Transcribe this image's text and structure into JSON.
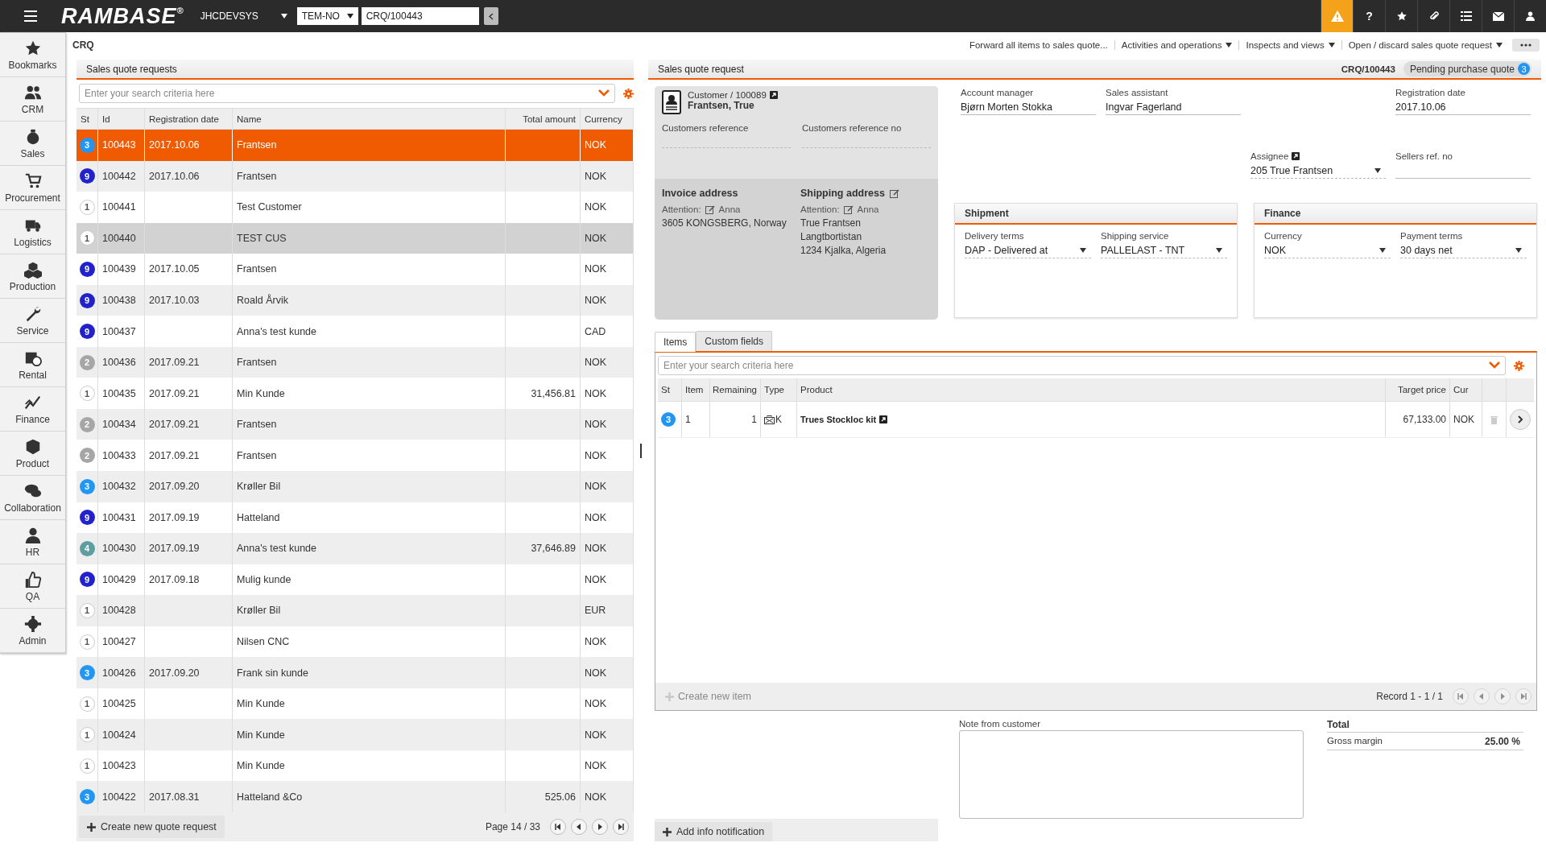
{
  "header": {
    "app_name": "RAMBASE",
    "registered": "®",
    "system": "JHCDEVSYS",
    "company": "TEM-NO",
    "document": "CRQ/100443",
    "help": "?"
  },
  "sidebar": {
    "items": [
      {
        "label": "Bookmarks"
      },
      {
        "label": "CRM"
      },
      {
        "label": "Sales"
      },
      {
        "label": "Procurement"
      },
      {
        "label": "Logistics"
      },
      {
        "label": "Production"
      },
      {
        "label": "Service"
      },
      {
        "label": "Rental"
      },
      {
        "label": "Finance"
      },
      {
        "label": "Product"
      },
      {
        "label": "Collaboration"
      },
      {
        "label": "HR"
      },
      {
        "label": "QA"
      },
      {
        "label": "Admin"
      }
    ]
  },
  "page_title": "CRQ",
  "actions": [
    {
      "label": "Forward all items to sales quote...",
      "dropdown": false
    },
    {
      "label": "Activities and operations",
      "dropdown": true
    },
    {
      "label": "Inspects and views",
      "dropdown": true
    },
    {
      "label": "Open / discard sales quote request",
      "dropdown": true
    }
  ],
  "list": {
    "title": "Sales quote requests",
    "search": {
      "placeholder": "Enter your search criteria here"
    },
    "columns": [
      "St",
      "Id",
      "Registration date",
      "Name",
      "Total amount",
      "Currency"
    ],
    "rows": [
      {
        "status": "3",
        "color": "#2196f3",
        "id": "100443",
        "date": "2017.10.06",
        "name": "Frantsen",
        "currency": "NOK",
        "selected": true,
        "hovered": false
      },
      {
        "status": "9",
        "color": "#2222cc",
        "id": "100442",
        "date": "2017.10.06",
        "name": "Frantsen",
        "currency": "NOK",
        "selected": false,
        "hovered": false
      },
      {
        "status": "1",
        "color": "#ffffff",
        "id": "100441",
        "name": "Test Customer",
        "currency": "NOK",
        "selected": false,
        "hovered": false
      },
      {
        "status": "1",
        "color": "#ffffff",
        "id": "100440",
        "name": "TEST CUS",
        "currency": "NOK",
        "selected": false,
        "hovered": true
      },
      {
        "status": "9",
        "color": "#2222cc",
        "id": "100439",
        "date": "2017.10.05",
        "name": "Frantsen",
        "currency": "NOK",
        "selected": false,
        "hovered": false
      },
      {
        "status": "9",
        "color": "#2222cc",
        "id": "100438",
        "date": "2017.10.03",
        "name": "Roald Årvik",
        "currency": "NOK",
        "selected": false,
        "hovered": false
      },
      {
        "status": "9",
        "color": "#2222cc",
        "id": "100437",
        "name": "Anna's test kunde",
        "currency": "CAD",
        "selected": false,
        "hovered": false
      },
      {
        "status": "2",
        "color": "#a6a6a6",
        "id": "100436",
        "date": "2017.09.21",
        "name": "Frantsen",
        "currency": "NOK",
        "selected": false,
        "hovered": false
      },
      {
        "status": "1",
        "color": "#ffffff",
        "id": "100435",
        "date": "2017.09.21",
        "name": "Min Kunde",
        "total": "31,456.81",
        "currency": "NOK",
        "selected": false,
        "hovered": false
      },
      {
        "status": "2",
        "color": "#a6a6a6",
        "id": "100434",
        "date": "2017.09.21",
        "name": "Frantsen",
        "currency": "NOK",
        "selected": false,
        "hovered": false
      },
      {
        "status": "2",
        "color": "#a6a6a6",
        "id": "100433",
        "date": "2017.09.21",
        "name": "Frantsen",
        "currency": "NOK",
        "selected": false,
        "hovered": false
      },
      {
        "status": "3",
        "color": "#2196f3",
        "id": "100432",
        "date": "2017.09.20",
        "name": "Krøller Bil",
        "currency": "NOK",
        "selected": false,
        "hovered": false
      },
      {
        "status": "9",
        "color": "#2222cc",
        "id": "100431",
        "date": "2017.09.19",
        "name": "Hatteland",
        "currency": "NOK",
        "selected": false,
        "hovered": false
      },
      {
        "status": "4",
        "color": "#5f9ea0",
        "id": "100430",
        "date": "2017.09.19",
        "name": "Anna's test kunde",
        "total": "37,646.89",
        "currency": "NOK",
        "selected": false,
        "hovered": false
      },
      {
        "status": "9",
        "color": "#2222cc",
        "id": "100429",
        "date": "2017.09.18",
        "name": "Mulig kunde",
        "currency": "NOK",
        "selected": false,
        "hovered": false
      },
      {
        "status": "1",
        "color": "#ffffff",
        "id": "100428",
        "name": "Krøller Bil",
        "currency": "EUR",
        "selected": false,
        "hovered": false
      },
      {
        "status": "1",
        "color": "#ffffff",
        "id": "100427",
        "name": "Nilsen CNC",
        "currency": "NOK",
        "selected": false,
        "hovered": false
      },
      {
        "status": "3",
        "color": "#2196f3",
        "id": "100426",
        "date": "2017.09.20",
        "name": "Frank sin kunde",
        "currency": "NOK",
        "selected": false,
        "hovered": false
      },
      {
        "status": "1",
        "color": "#ffffff",
        "id": "100425",
        "name": "Min Kunde",
        "currency": "NOK",
        "selected": false,
        "hovered": false
      },
      {
        "status": "1",
        "color": "#ffffff",
        "id": "100424",
        "name": "Min Kunde",
        "currency": "NOK",
        "selected": false,
        "hovered": false
      },
      {
        "status": "1",
        "color": "#ffffff",
        "id": "100423",
        "name": "Min Kunde",
        "currency": "NOK",
        "selected": false,
        "hovered": false
      },
      {
        "status": "3",
        "color": "#2196f3",
        "id": "100422",
        "date": "2017.08.31",
        "name": "Hatteland &Co",
        "total": "525.06",
        "currency": "NOK",
        "selected": false,
        "hovered": false
      }
    ],
    "create_button": "Create new quote request",
    "page": "Page 14 / 33"
  },
  "detail": {
    "title": "Sales quote request",
    "doc_id": "CRQ/100443",
    "status": {
      "label": "Pending purchase quote",
      "count": "3"
    },
    "customer": {
      "label": "Customer / 100089",
      "name": "Frantsen, True",
      "reference_label": "Customers reference",
      "reference_no_label": "Customers reference no"
    },
    "invoice_address": {
      "title": "Invoice address",
      "editable": false,
      "attention_label": "Attention:",
      "attention": "Anna",
      "lines": [
        "3605 KONGSBERG, Norway"
      ]
    },
    "shipping_address": {
      "title": "Shipping address",
      "editable": true,
      "attention_label": "Attention:",
      "attention": "Anna",
      "lines": [
        "True Frantsen",
        "Langtbortistan",
        "1234 Kjalka, Algeria"
      ]
    },
    "fields": [
      {
        "label": "Account manager",
        "value": "Bjørn Morten Stokka",
        "kind": "text"
      },
      {
        "label": "Sales assistant",
        "value": "Ingvar Fagerland",
        "kind": "text"
      },
      {
        "label": "Registration date",
        "value": "2017.10.06",
        "kind": "text"
      },
      {
        "label": "Assignee",
        "value": "205 True  Frantsen",
        "kind": "dropdown"
      },
      {
        "label": "Sellers ref. no",
        "kind": "text"
      }
    ],
    "shipment": {
      "title": "Shipment",
      "fields": [
        {
          "label": "Delivery terms",
          "value": "DAP - Delivered at"
        },
        {
          "label": "Shipping service",
          "value": "PALLELAST - TNT"
        }
      ]
    },
    "finance": {
      "title": "Finance",
      "fields": [
        {
          "label": "Currency",
          "value": "NOK"
        },
        {
          "label": "Payment terms",
          "value": "30 days net"
        }
      ]
    },
    "tabs": [
      {
        "label": "Items",
        "selected": true
      },
      {
        "label": "Custom fields",
        "selected": false
      }
    ],
    "items": {
      "search": {
        "placeholder": "Enter your search criteria here"
      },
      "columns": [
        "St",
        "Item",
        "Remaining",
        "Type",
        "Product",
        "Target price",
        "Cur"
      ],
      "rows": [
        {
          "status": "3",
          "color": "#2196f3",
          "item": "1",
          "remaining": "1",
          "type": "K",
          "product": "Trues Stockloc kit",
          "target_price": "67,133.00",
          "currency": "NOK"
        }
      ],
      "create_button": {
        "label": "Create new item",
        "disabled": true
      },
      "record": "Record 1 - 1 / 1"
    },
    "add_info_button": "Add info notification",
    "note": {
      "label": "Note from customer"
    },
    "total": {
      "title": "Total",
      "rows": [
        {
          "label": "Gross margin",
          "value": "25.00 %"
        }
      ]
    }
  }
}
